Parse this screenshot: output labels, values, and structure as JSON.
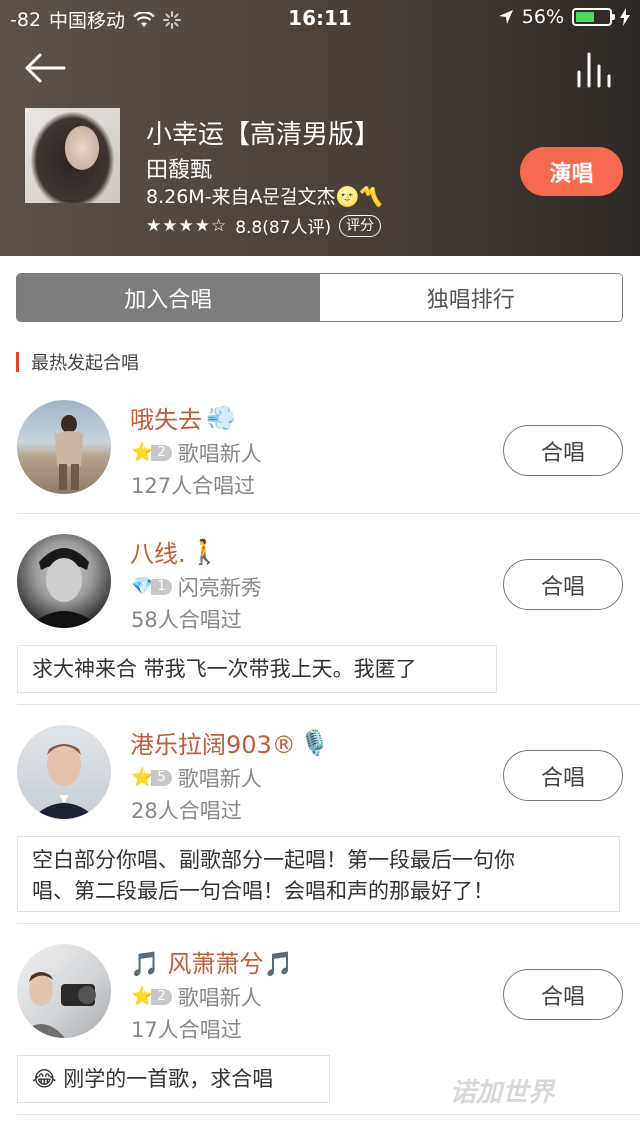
{
  "status_bar": {
    "signal": "-82",
    "carrier": "中国移动",
    "time": "16:11",
    "battery": "56%",
    "battery_level": 0.56
  },
  "song": {
    "title": "小幸运【高清男版】",
    "artist": "田馥甄",
    "meta": "8.26M-来自A문걸文杰🌝〽️",
    "stars": "★★★★☆",
    "rating": "8.8(87人评)",
    "rate_label": "评分",
    "sing_label": "演唱"
  },
  "tabs": [
    {
      "label": "加入合唱",
      "active": true
    },
    {
      "label": "独唱排行",
      "active": false
    }
  ],
  "section_title": "最热发起合唱",
  "items": [
    {
      "name": "哦失去",
      "name_emoji": "💨",
      "level_icon": "⭐",
      "level_num": "2",
      "level_title": "歌唱新人",
      "count": "127人合唱过",
      "button": "合唱",
      "comment": ""
    },
    {
      "name": "八线.",
      "name_emoji": "🚶",
      "level_icon": "💎",
      "level_num": "1",
      "level_title": "闪亮新秀",
      "count": "58人合唱过",
      "button": "合唱",
      "comment": "求大神来合 带我飞一次带我上天。我匿了"
    },
    {
      "name": "港乐拉阔903®",
      "name_emoji": "🎙️",
      "level_icon": "⭐",
      "level_num": "5",
      "level_title": "歌唱新人",
      "count": "28人合唱过",
      "button": "合唱",
      "comment_line1": "空白部分你唱、副歌部分一起唱！第一段最后一句你",
      "comment_line2": "唱、第二段最后一句合唱！会唱和声的那最好了！"
    },
    {
      "name": "🎵 风萧萧兮🎵",
      "name_emoji": "",
      "level_icon": "⭐",
      "level_num": "2",
      "level_title": "歌唱新人",
      "count": "17人合唱过",
      "button": "合唱",
      "comment": "😂 刚学的一首歌，求合唱"
    }
  ],
  "watermark": "诺加世界"
}
